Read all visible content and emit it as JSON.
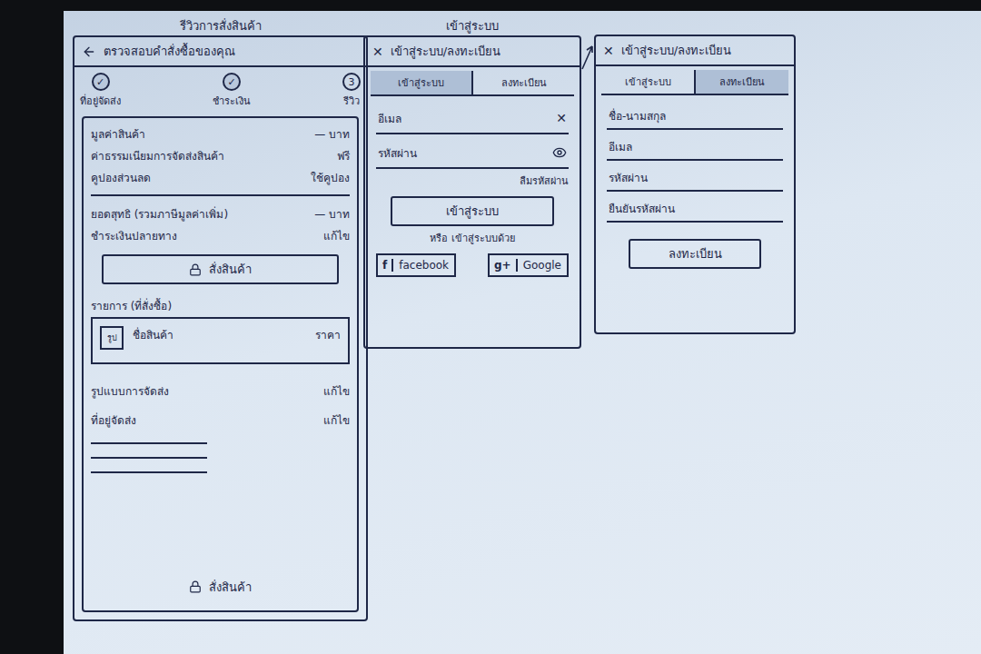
{
  "order_screen": {
    "caption": "รีวิวการสั่งสินค้า",
    "header": {
      "back_icon": "←",
      "title": "ตรวจสอบคำสั่งซื้อของคุณ"
    },
    "steps": [
      {
        "mark": "✓",
        "label": "ที่อยู่จัดส่ง",
        "done": true
      },
      {
        "mark": "✓",
        "label": "ชำระเงิน",
        "done": true
      },
      {
        "mark": "3",
        "label": "รีวิว",
        "done": false
      }
    ],
    "summary_rows": [
      {
        "label": "มูลค่าสินค้า",
        "value": "— บาท"
      },
      {
        "label": "ค่าธรรมเนียมการจัดส่งสินค้า",
        "value": "ฟรี"
      },
      {
        "label": "คูปองส่วนลด",
        "value": "ใช้คูปอง"
      }
    ],
    "total_rows": [
      {
        "label": "ยอดสุทธิ (รวมภาษีมูลค่าเพิ่ม)",
        "value": "— บาท"
      },
      {
        "label": "ชำระเงินปลายทาง",
        "value": "แก้ไข"
      }
    ],
    "order_button": "สั่งสินค้า",
    "items_heading": "รายการ (ที่สั่งซื้อ)",
    "items": [
      {
        "image": "รูป",
        "name": "ชื่อสินค้า",
        "price": "ราคา"
      }
    ],
    "detail_rows": [
      {
        "label": "รูปแบบการจัดส่ง",
        "action": "แก้ไข"
      },
      {
        "label": "ที่อยู่จัดส่ง",
        "action": "แก้ไข"
      }
    ],
    "bottom_button": "สั่งสินค้า"
  },
  "login_screen": {
    "caption": "เข้าสู่ระบบ",
    "header": {
      "close_icon": "✕",
      "title": "เข้าสู่ระบบ/ลงทะเบียน"
    },
    "tabs": [
      {
        "label": "เข้าสู่ระบบ",
        "selected": true
      },
      {
        "label": "ลงทะเบียน",
        "selected": false
      }
    ],
    "fields": [
      {
        "label": "อีเมล",
        "kind": "clear",
        "icon": "✕"
      },
      {
        "label": "รหัสผ่าน",
        "kind": "password",
        "icon": ""
      }
    ],
    "forgot": "ลืมรหัสผ่าน",
    "submit": "เข้าสู่ระบบ",
    "alt_text": "หรือ เข้าสู่ระบบด้วย",
    "social": [
      {
        "icon": "f",
        "label": "facebook"
      },
      {
        "icon": "g+",
        "label": "Google"
      }
    ]
  },
  "register_screen": {
    "header": {
      "close_icon": "✕",
      "title": "เข้าสู่ระบบ/ลงทะเบียน"
    },
    "tabs": [
      {
        "label": "เข้าสู่ระบบ",
        "selected": false
      },
      {
        "label": "ลงทะเบียน",
        "selected": true
      }
    ],
    "fields": [
      {
        "label": "ชื่อ-นามสกุล"
      },
      {
        "label": "อีเมล"
      },
      {
        "label": "รหัสผ่าน"
      },
      {
        "label": "ยืนยันรหัสผ่าน"
      }
    ],
    "submit": "ลงทะเบียน"
  }
}
